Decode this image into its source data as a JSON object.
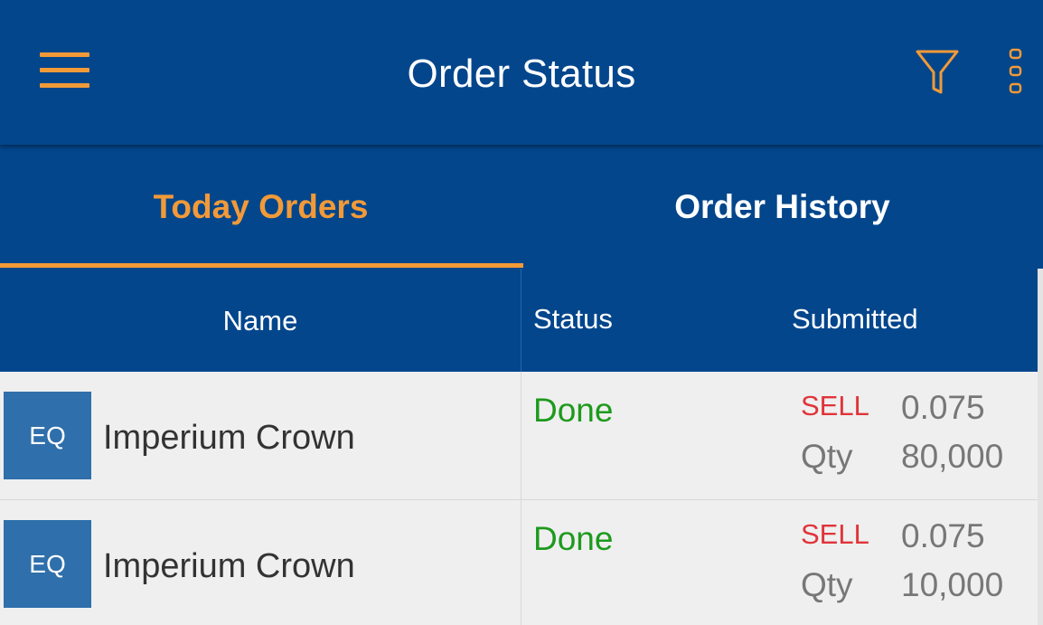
{
  "app_bar": {
    "title": "Order Status",
    "menu_icon": "hamburger-menu-icon",
    "filter_icon": "filter-funnel-icon",
    "more_icon": "more-vertical-icon"
  },
  "tabs": [
    {
      "label": "Today Orders",
      "selected": true
    },
    {
      "label": "Order History",
      "selected": false
    }
  ],
  "table": {
    "columns": [
      "Name",
      "Status",
      "Submitted"
    ],
    "rows": [
      {
        "badge": "EQ",
        "name": "Imperium Crown",
        "status": "Done",
        "side": "SELL",
        "price": "0.075",
        "qty_label": "Qty",
        "qty": "80,000"
      },
      {
        "badge": "EQ",
        "name": "Imperium Crown",
        "status": "Done",
        "side": "SELL",
        "price": "0.075",
        "qty_label": "Qty",
        "qty": "10,000"
      }
    ]
  },
  "colors": {
    "primary": "#03468c",
    "accent": "#f29a38",
    "status_done": "#1d9a1d",
    "sell": "#e0343a",
    "badge": "#2f6fab"
  }
}
